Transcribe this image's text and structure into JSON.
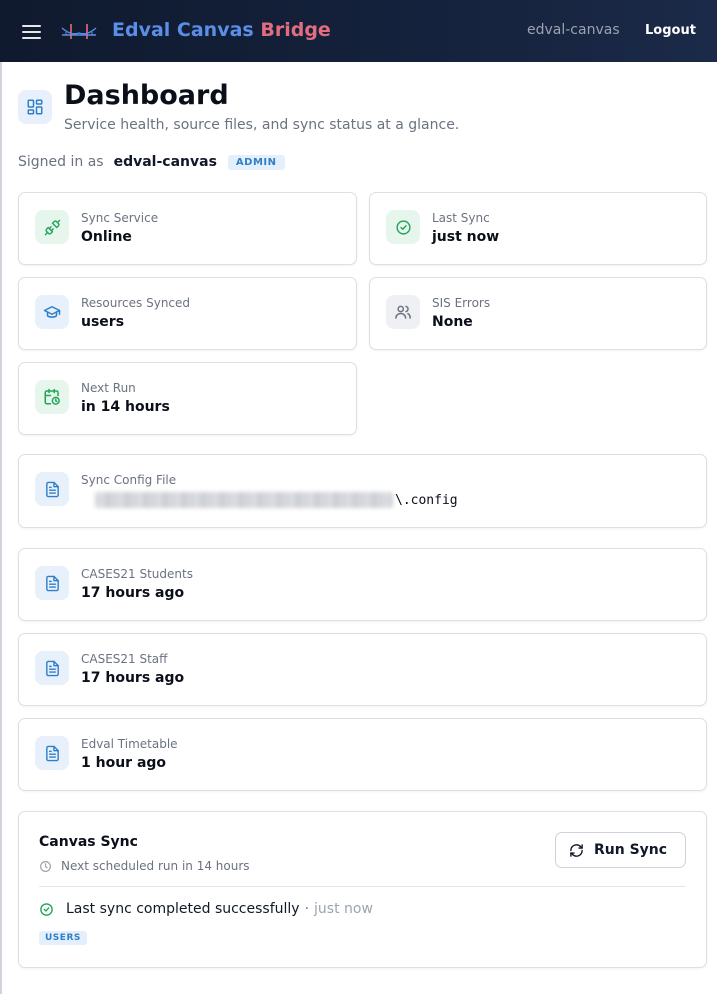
{
  "header": {
    "brand_part1": "Edval Canvas",
    "brand_part2": "Bridge",
    "username": "edval-canvas",
    "logout_label": "Logout"
  },
  "page": {
    "title": "Dashboard",
    "subtitle": "Service health, source files, and sync status at a glance.",
    "signed_in_label": "Signed in as",
    "signed_in_user": "edval-canvas",
    "role_badge": "ADMIN"
  },
  "stats": {
    "sync_service": {
      "label": "Sync Service",
      "value": "Online",
      "icon": "plug-icon"
    },
    "last_sync": {
      "label": "Last Sync",
      "value": "just now",
      "icon": "check-circle-icon"
    },
    "resources_synced": {
      "label": "Resources Synced",
      "value": "users",
      "icon": "graduation-cap-icon"
    },
    "sis_errors": {
      "label": "SIS Errors",
      "value": "None",
      "icon": "users-icon"
    },
    "next_run": {
      "label": "Next Run",
      "value": "in 14 hours",
      "icon": "calendar-clock-icon"
    }
  },
  "config": {
    "label": "Sync Config File",
    "path_suffix": "\\.config",
    "icon": "file-icon"
  },
  "sources": [
    {
      "label": "CASES21 Students",
      "value": "17 hours ago",
      "icon": "file-icon"
    },
    {
      "label": "CASES21 Staff",
      "value": "17 hours ago",
      "icon": "file-icon"
    },
    {
      "label": "Edval Timetable",
      "value": "1 hour ago",
      "icon": "file-icon"
    }
  ],
  "sync_panel": {
    "title": "Canvas Sync",
    "next_scheduled": "Next scheduled run in 14 hours",
    "run_button_label": "Run Sync",
    "status_message": "Last sync completed successfully",
    "status_separator": "·",
    "status_time": "just now",
    "resource_tag": "USERS"
  },
  "colors": {
    "header_bg": "#15223d",
    "brand_blue": "#5b8ee6",
    "brand_pink": "#e26d80",
    "accent_green": "#22a55a",
    "accent_blue": "#2f7fc8"
  }
}
